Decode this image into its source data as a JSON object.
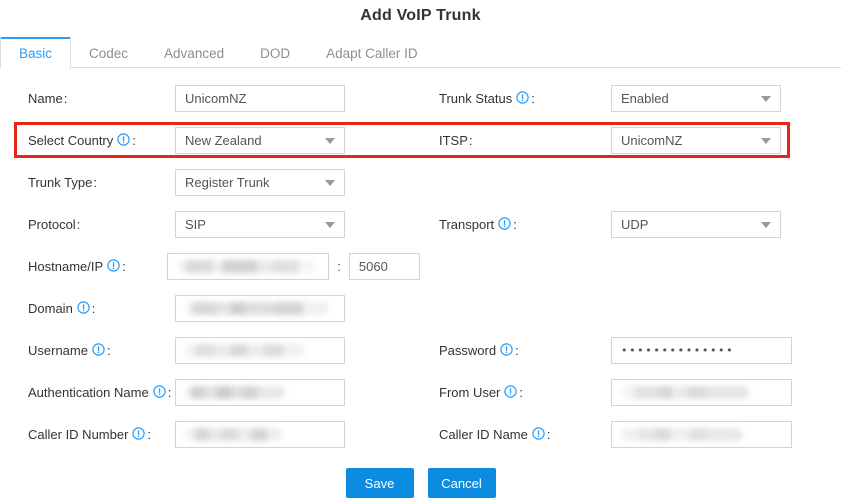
{
  "dialog": {
    "title": "Add VoIP Trunk"
  },
  "tabs": [
    {
      "label": "Basic",
      "active": true
    },
    {
      "label": "Codec",
      "active": false
    },
    {
      "label": "Advanced",
      "active": false
    },
    {
      "label": "DOD",
      "active": false
    },
    {
      "label": "Adapt Caller ID",
      "active": false
    }
  ],
  "form": {
    "name": {
      "label": "Name",
      "value": "UnicomNZ",
      "has_info": false
    },
    "trunk_status": {
      "label": "Trunk Status",
      "value": "Enabled",
      "has_info": true
    },
    "select_country": {
      "label": "Select Country",
      "value": "New Zealand",
      "has_info": true
    },
    "itsp": {
      "label": "ITSP",
      "value": "UnicomNZ",
      "has_info": false
    },
    "trunk_type": {
      "label": "Trunk Type",
      "value": "Register Trunk",
      "has_info": false
    },
    "protocol": {
      "label": "Protocol",
      "value": "SIP",
      "has_info": false
    },
    "transport": {
      "label": "Transport",
      "value": "UDP",
      "has_info": true
    },
    "hostname_ip": {
      "label": "Hostname/IP",
      "value": "",
      "redacted": true,
      "has_info": true,
      "separator": ":"
    },
    "port": {
      "value": "5060"
    },
    "domain": {
      "label": "Domain",
      "value": "",
      "redacted": true,
      "has_info": true
    },
    "username": {
      "label": "Username",
      "value": "",
      "redacted": true,
      "has_info": true
    },
    "password": {
      "label": "Password",
      "value": "••••••••••••••",
      "has_info": true
    },
    "authentication_name": {
      "label": "Authentication Name",
      "value": "",
      "redacted": true,
      "has_info": true
    },
    "from_user": {
      "label": "From User",
      "value": "",
      "redacted": true,
      "has_info": true
    },
    "caller_id_number": {
      "label": "Caller ID Number",
      "value": "",
      "redacted": true,
      "has_info": true
    },
    "caller_id_name": {
      "label": "Caller ID Name",
      "value": "",
      "redacted": true,
      "has_info": true
    },
    "colon": ":"
  },
  "buttons": {
    "save": "Save",
    "cancel": "Cancel"
  },
  "colors": {
    "accent": "#2b9df4",
    "button": "#0c8ce0",
    "highlight": "#e8251b",
    "info_icon": "#2b9df4",
    "border": "#d4d4d4"
  }
}
